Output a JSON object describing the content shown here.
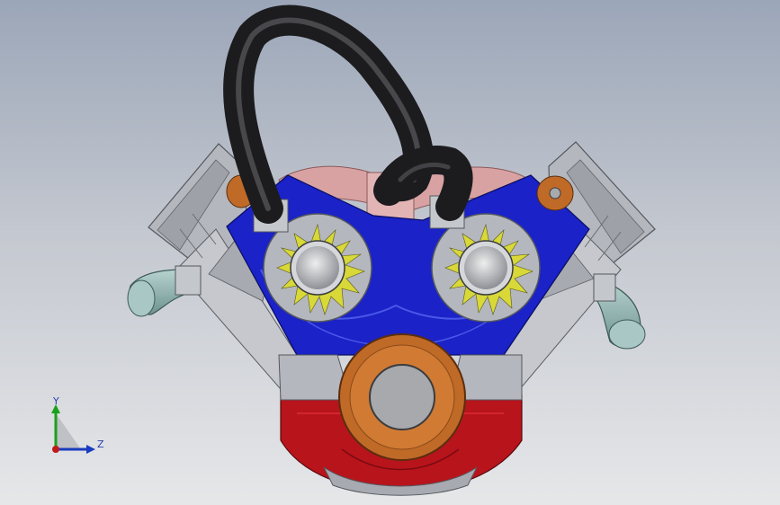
{
  "viewport": {
    "background_top": "#9ba6b8",
    "background_bottom": "#e6e7e9"
  },
  "model": {
    "colors": {
      "housing_blue": "#1a22c8",
      "sump_red": "#b8141c",
      "head_grey": "#b4b7bd",
      "hose_black": "#1c1c1e",
      "copper": "#c06a28",
      "fitting_teal": "#8fb3b0",
      "gear_yellow": "#d8d838",
      "manifold_pink": "#d9a2a2"
    }
  },
  "triad": {
    "y_label": "Y",
    "z_label": "Z",
    "icon": "coordinate-triad-icon",
    "colors": {
      "y": "#1aa01a",
      "z": "#1a3cc0",
      "x": "#c01a1a"
    }
  }
}
